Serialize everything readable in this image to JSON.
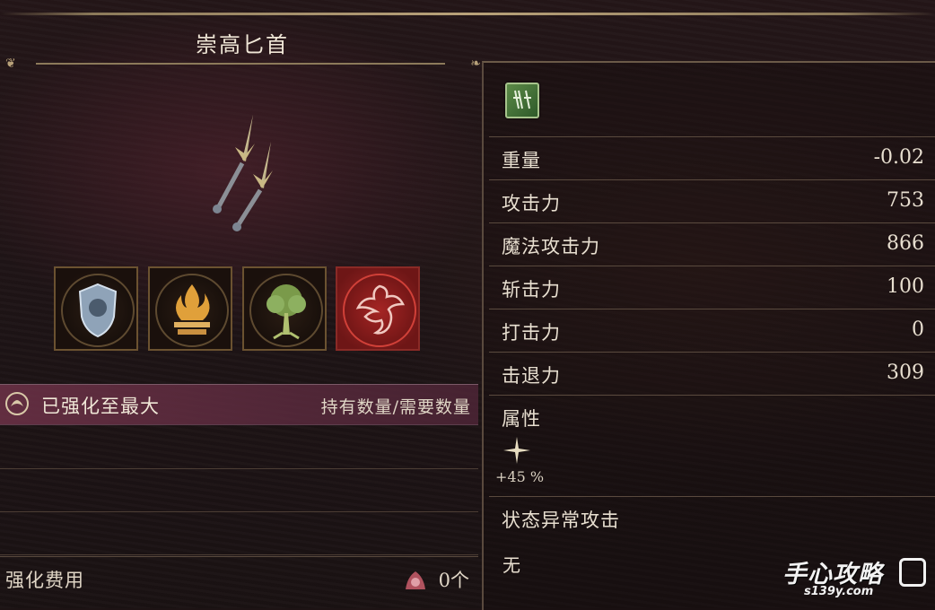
{
  "item": {
    "name": "崇高匕首",
    "icon": "twin-daggers-icon"
  },
  "weapon_type_icon": "dagger-category-icon",
  "stats": [
    {
      "label": "重量",
      "value": "-0.02"
    },
    {
      "label": "攻击力",
      "value": "753"
    },
    {
      "label": "魔法攻击力",
      "value": "866"
    },
    {
      "label": "斩击力",
      "value": "100"
    },
    {
      "label": "打击力",
      "value": "0"
    },
    {
      "label": "击退力",
      "value": "309"
    }
  ],
  "attribute": {
    "label": "属性",
    "icon": "star-burst-icon",
    "value": "+45 %"
  },
  "status_attack": {
    "label": "状态异常攻击",
    "value": "无"
  },
  "affinities": [
    {
      "name": "lion-shield-icon",
      "selected": false
    },
    {
      "name": "flame-altar-icon",
      "selected": false
    },
    {
      "name": "tree-icon",
      "selected": false
    },
    {
      "name": "dragon-icon",
      "selected": true
    }
  ],
  "upgrade": {
    "label": "已强化至最大",
    "header": "持有数量/需要数量",
    "icon": "upgrade-emblem-icon"
  },
  "cost": {
    "label": "强化费用",
    "value": "0个",
    "icon": "soul-currency-icon"
  },
  "watermark": {
    "main": "手心攻略",
    "sub": "s139y.com"
  }
}
